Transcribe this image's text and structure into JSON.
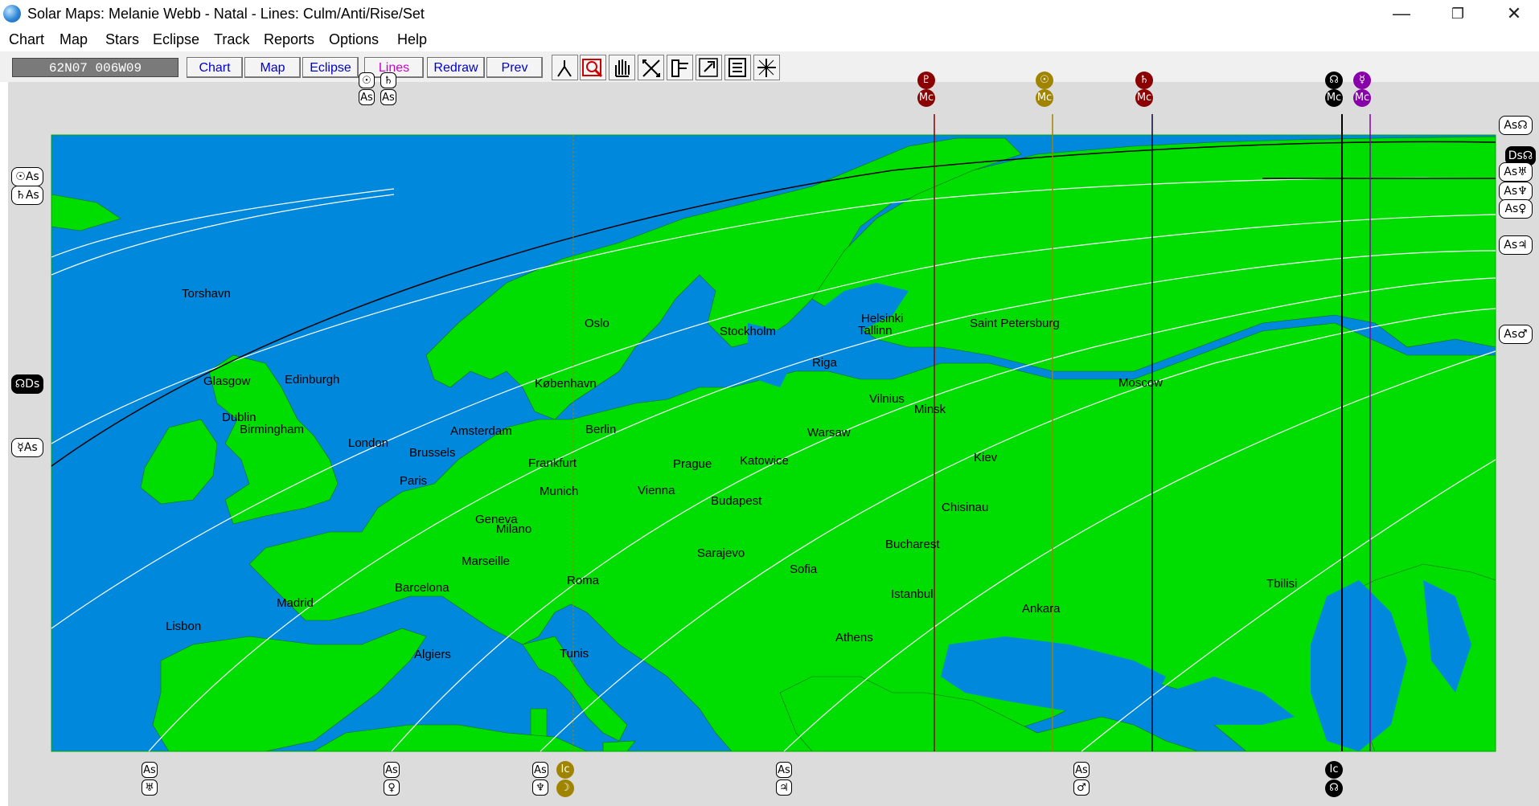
{
  "window": {
    "title": "Solar Maps: Melanie Webb - Natal - Lines: Culm/Anti/Rise/Set",
    "controls": {
      "minimize": "—",
      "restore": "❐",
      "close": "✕"
    }
  },
  "menu": [
    "Chart",
    "Map",
    "Stars",
    "Eclipse",
    "Track",
    "Reports",
    "Options",
    "Help"
  ],
  "toolbar": {
    "coordinates": "62N07  006W09",
    "buttons": [
      {
        "label": "Chart",
        "color": "#0000cc"
      },
      {
        "label": "Map",
        "color": "#0000cc"
      },
      {
        "label": "Eclipse",
        "color": "#0000cc"
      },
      {
        "label": "Lines",
        "color": "#cc00cc"
      },
      {
        "label": "Redraw",
        "color": "#0000cc"
      },
      {
        "label": "Prev",
        "color": "#0000cc"
      }
    ],
    "tools": [
      "person-icon",
      "zoom-icon",
      "hand-icon",
      "cross-icon",
      "pin-icon",
      "plus-icon",
      "info-icon",
      "crosshair-icon"
    ]
  },
  "map": {
    "colors": {
      "land": "#00dd00",
      "sea": "#0088dd",
      "border_bg": "#dcdcdc",
      "line_white": "#ffffff",
      "line_black": "#000000",
      "line_red": "#8b0000",
      "line_olive": "#a08400",
      "line_purple": "#8800aa",
      "line_navy": "#0a0a3a"
    },
    "cities": [
      {
        "name": "Torshavn"
      },
      {
        "name": "Oslo"
      },
      {
        "name": "Stockholm"
      },
      {
        "name": "Helsinki"
      },
      {
        "name": "Tallinn"
      },
      {
        "name": "Saint Petersburg"
      },
      {
        "name": "Glasgow"
      },
      {
        "name": "Edinburgh"
      },
      {
        "name": "København"
      },
      {
        "name": "Riga"
      },
      {
        "name": "Moscow"
      },
      {
        "name": "Vilnius"
      },
      {
        "name": "Minsk"
      },
      {
        "name": "Dublin"
      },
      {
        "name": "Birmingham"
      },
      {
        "name": "Amsterdam"
      },
      {
        "name": "Berlin"
      },
      {
        "name": "Warsaw"
      },
      {
        "name": "London"
      },
      {
        "name": "Brussels"
      },
      {
        "name": "Frankfurt"
      },
      {
        "name": "Prague"
      },
      {
        "name": "Katowice"
      },
      {
        "name": "Kiev"
      },
      {
        "name": "Paris"
      },
      {
        "name": "Munich"
      },
      {
        "name": "Vienna"
      },
      {
        "name": "Budapest"
      },
      {
        "name": "Chisinau"
      },
      {
        "name": "Geneva"
      },
      {
        "name": "Milano"
      },
      {
        "name": "Bucharest"
      },
      {
        "name": "Marseille"
      },
      {
        "name": "Sarajevo"
      },
      {
        "name": "Sofia"
      },
      {
        "name": "Barcelona"
      },
      {
        "name": "Roma"
      },
      {
        "name": "Istanbul"
      },
      {
        "name": "Tbilisi"
      },
      {
        "name": "Madrid"
      },
      {
        "name": "Ankara"
      },
      {
        "name": "Lisbon"
      },
      {
        "name": "Athens"
      },
      {
        "name": "Algiers"
      },
      {
        "name": "Tunis"
      }
    ],
    "planet_symbols": {
      "sun": "☉",
      "moon": "☽",
      "mercury": "☿",
      "venus": "♀",
      "mars": "♂",
      "jupiter": "♃",
      "saturn": "♄",
      "uranus": "♅",
      "neptune": "♆",
      "pluto": "♇",
      "node": "☊",
      "asc": "As",
      "mc": "Mc",
      "ic": "Ic",
      "ds": "Ds"
    },
    "left_labels": [
      {
        "text": "☉As"
      },
      {
        "text": "♄As"
      },
      {
        "text": "☊Ds"
      },
      {
        "text": "☿As"
      }
    ],
    "right_labels": [
      {
        "text": "As☊"
      },
      {
        "text": "Ds☊"
      },
      {
        "text": "As♅"
      },
      {
        "text": "As♆"
      },
      {
        "text": "As♀"
      },
      {
        "text": "As♃"
      },
      {
        "text": "As♂"
      }
    ],
    "top_labels": [
      {
        "planet": "☉",
        "angle": "As",
        "color": "#ffffff",
        "dark": false
      },
      {
        "planet": "♄",
        "angle": "As",
        "color": "#ffffff",
        "dark": false
      },
      {
        "planet": "♇",
        "angle": "Mc",
        "color": "#8b0000",
        "dark": false
      },
      {
        "planet": "☉",
        "angle": "Mc",
        "color": "#a08400",
        "dark": false
      },
      {
        "planet": "♄",
        "angle": "Mc",
        "color": "#8b0000",
        "dark": false
      },
      {
        "planet": "☊",
        "angle": "Mc",
        "color": "#000000",
        "dark": true
      },
      {
        "planet": "☿",
        "angle": "Mc",
        "color": "#8800aa",
        "dark": false
      }
    ],
    "bottom_labels": [
      {
        "angle": "As",
        "planet": "♅",
        "color": "#ffffff",
        "dark": false
      },
      {
        "angle": "As",
        "planet": "♀",
        "color": "#ffffff",
        "dark": false
      },
      {
        "angle": "As",
        "planet": "♆",
        "color": "#ffffff",
        "dark": false
      },
      {
        "angle": "Ic",
        "planet": "☽",
        "color": "#a08400",
        "dark": false
      },
      {
        "angle": "As",
        "planet": "♃",
        "color": "#ffffff",
        "dark": false
      },
      {
        "angle": "As",
        "planet": "♂",
        "color": "#ffffff",
        "dark": false
      },
      {
        "angle": "Ic",
        "planet": "☊",
        "color": "#000000",
        "dark": true
      }
    ]
  }
}
